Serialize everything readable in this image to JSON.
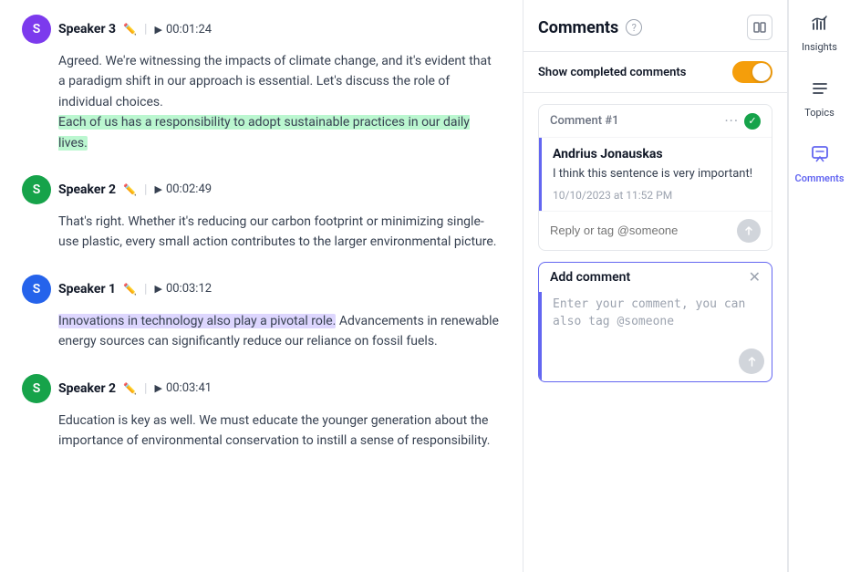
{
  "transcript": {
    "entries": [
      {
        "id": "entry-1",
        "speaker": "Speaker 3",
        "avatarColor": "purple",
        "avatarInitial": "S",
        "timestamp": "00:01:24",
        "text": "Agreed. We're witnessing the impacts of climate change, and it's evident that a paradigm shift in our approach is essential. Let's discuss the role of individual choices.",
        "highlightedPart": "Each of us has a responsibility to adopt sustainable practices in our daily lives.",
        "highlightColor": "green"
      },
      {
        "id": "entry-2",
        "speaker": "Speaker 2",
        "avatarColor": "green",
        "avatarInitial": "S",
        "timestamp": "00:02:49",
        "text": "That's right. Whether it's reducing our carbon footprint or minimizing single-use plastic, every small action contributes to the larger environmental picture.",
        "highlightedPart": null,
        "highlightColor": null
      },
      {
        "id": "entry-3",
        "speaker": "Speaker 1",
        "avatarColor": "blue",
        "avatarInitial": "S",
        "timestamp": "00:03:12",
        "highlightedPart": "Innovations in technology also play a pivotal role.",
        "highlightColor": "purple",
        "text": " Advancements in renewable energy sources can significantly reduce our reliance on fossil fuels.",
        "textBeforeHighlight": "",
        "textAfterHighlight": " Advancements in renewable energy sources can significantly reduce our reliance on fossil fuels."
      },
      {
        "id": "entry-4",
        "speaker": "Speaker 2",
        "avatarColor": "green",
        "avatarInitial": "S",
        "timestamp": "00:03:41",
        "text": "Education is key as well. We must educate the younger generation about the importance of environmental conservation to instill a sense of responsibility.",
        "highlightedPart": null,
        "highlightColor": null
      }
    ]
  },
  "comments": {
    "panel_title": "Comments",
    "help_label": "?",
    "show_completed_label": "Show completed comments",
    "toggle_on": true,
    "items": [
      {
        "id": "comment-1",
        "number_label": "Comment #1",
        "author": "Andrius Jonauskas",
        "text": "I think this sentence is very important!",
        "date": "10/10/2023 at 11:52 PM",
        "completed": true,
        "reply_placeholder": "Reply or tag @someone"
      }
    ],
    "add_comment": {
      "title": "Add comment",
      "placeholder": "Enter your comment, you can also tag @someone"
    }
  },
  "sidebar": {
    "items": [
      {
        "id": "insights",
        "label": "Insights",
        "icon": "insights-icon",
        "active": false
      },
      {
        "id": "topics",
        "label": "Topics",
        "icon": "topics-icon",
        "active": false
      },
      {
        "id": "comments",
        "label": "Comments",
        "icon": "comments-icon",
        "active": true
      }
    ]
  }
}
